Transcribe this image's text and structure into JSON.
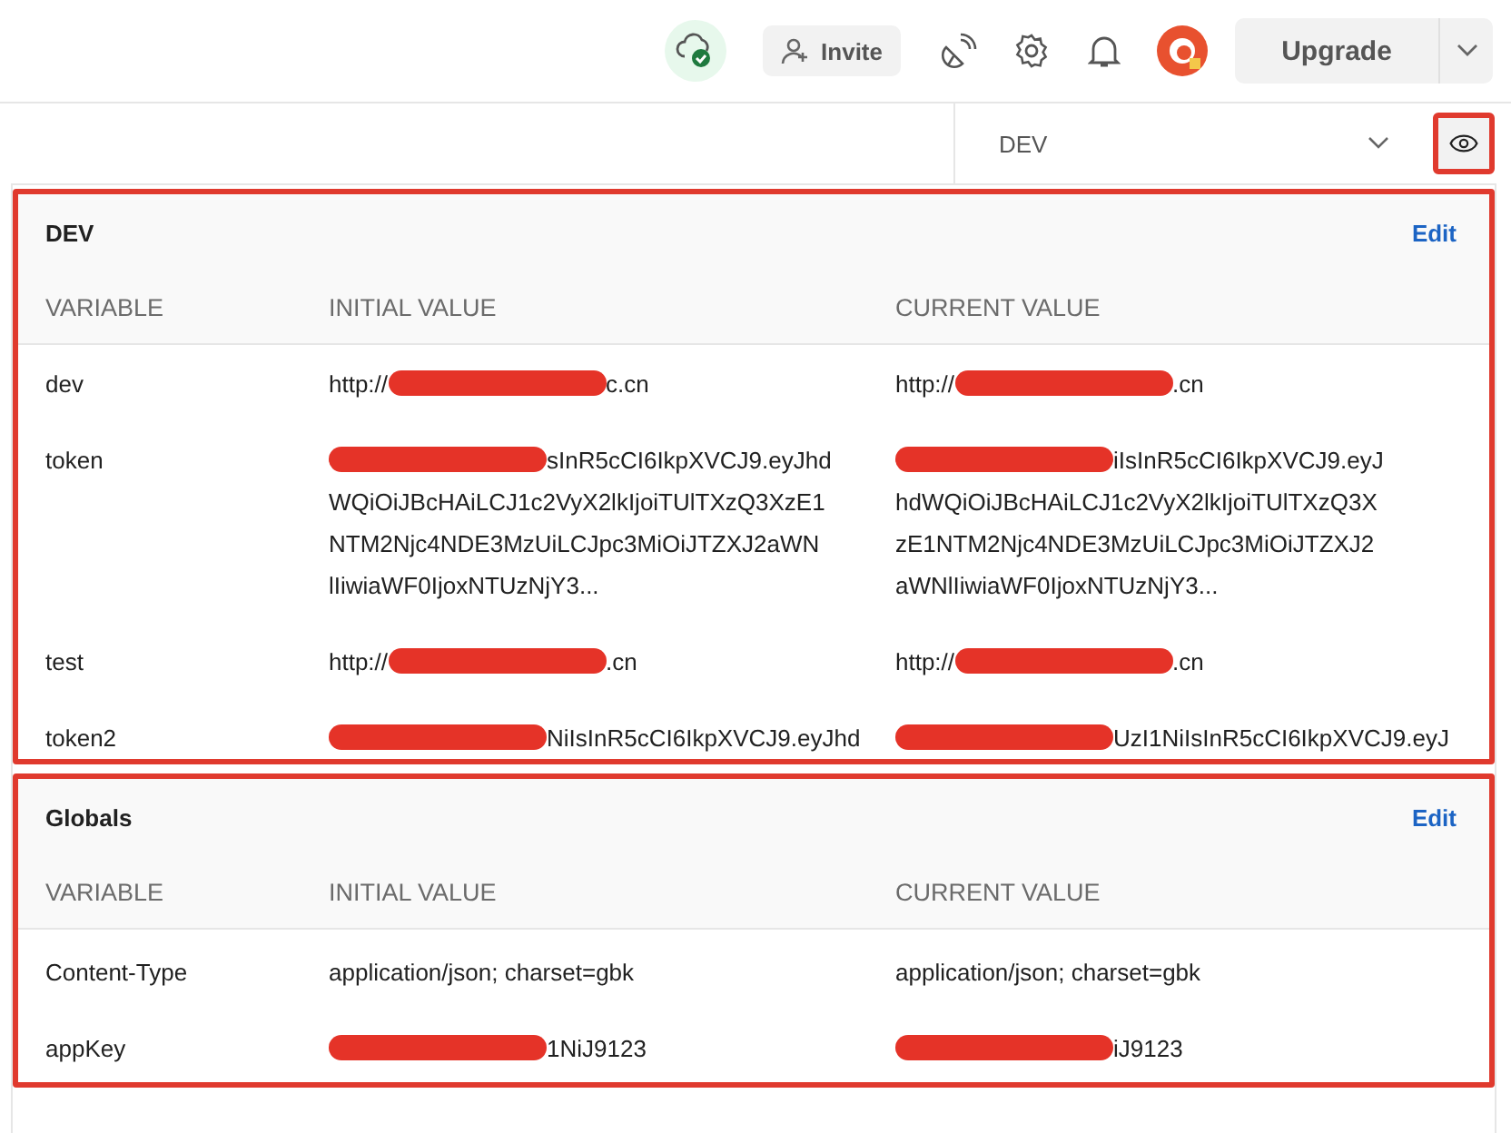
{
  "top_bar": {
    "invite_label": "Invite",
    "upgrade_label": "Upgrade"
  },
  "environment_selector": {
    "value": "DEV",
    "eye_highlighted": true
  },
  "sections": [
    {
      "title": "DEV",
      "edit_label": "Edit",
      "highlighted": true,
      "columns": [
        "VARIABLE",
        "INITIAL VALUE",
        "CURRENT VALUE"
      ],
      "rows": [
        {
          "variable": "dev",
          "initial": [
            [
              {
                "kind": "text",
                "text": "http://"
              },
              {
                "kind": "redacted"
              },
              {
                "kind": "text",
                "text": "c.cn"
              }
            ]
          ],
          "current": [
            [
              {
                "kind": "text",
                "text": "http://"
              },
              {
                "kind": "redacted"
              },
              {
                "kind": "text",
                "text": ".cn"
              }
            ]
          ]
        },
        {
          "variable": "token",
          "initial": [
            [
              {
                "kind": "redacted"
              },
              {
                "kind": "text",
                "text": "sInR5cCI6IkpXVCJ9.eyJhd"
              }
            ],
            [
              {
                "kind": "text",
                "text": "WQiOiJBcHAiLCJ1c2VyX2lkIjoiTUlTXzQ3XzE1"
              }
            ],
            [
              {
                "kind": "text",
                "text": "NTM2Njc4NDE3MzUiLCJpc3MiOiJTZXJ2aWN"
              }
            ],
            [
              {
                "kind": "text",
                "text": "lIiwiaWF0IjoxNTUzNjY3..."
              }
            ]
          ],
          "current": [
            [
              {
                "kind": "redacted"
              },
              {
                "kind": "text",
                "text": "iIsInR5cCI6IkpXVCJ9.eyJ"
              }
            ],
            [
              {
                "kind": "text",
                "text": "hdWQiOiJBcHAiLCJ1c2VyX2lkIjoiTUlTXzQ3X"
              }
            ],
            [
              {
                "kind": "text",
                "text": "zE1NTM2Njc4NDE3MzUiLCJpc3MiOiJTZXJ2"
              }
            ],
            [
              {
                "kind": "text",
                "text": "aWNlIiwiaWF0IjoxNTUzNjY3..."
              }
            ]
          ]
        },
        {
          "variable": "test",
          "initial": [
            [
              {
                "kind": "text",
                "text": "http://"
              },
              {
                "kind": "redacted"
              },
              {
                "kind": "text",
                "text": ".cn"
              }
            ]
          ],
          "current": [
            [
              {
                "kind": "text",
                "text": "http://"
              },
              {
                "kind": "redacted"
              },
              {
                "kind": "text",
                "text": ".cn"
              }
            ]
          ]
        },
        {
          "variable": "token2",
          "initial": [
            [
              {
                "kind": "redacted"
              },
              {
                "kind": "text",
                "text": "NiIsInR5cCI6IkpXVCJ9.eyJhd"
              }
            ]
          ],
          "current": [
            [
              {
                "kind": "redacted"
              },
              {
                "kind": "text",
                "text": "UzI1NiIsInR5cCI6IkpXVCJ9.eyJ"
              }
            ]
          ]
        }
      ]
    },
    {
      "title": "Globals",
      "edit_label": "Edit",
      "highlighted": true,
      "columns": [
        "VARIABLE",
        "INITIAL VALUE",
        "CURRENT VALUE"
      ],
      "rows": [
        {
          "variable": "Content-Type",
          "initial": [
            [
              {
                "kind": "text",
                "text": "application/json; charset=gbk"
              }
            ]
          ],
          "current": [
            [
              {
                "kind": "text",
                "text": "application/json; charset=gbk"
              }
            ]
          ]
        },
        {
          "variable": "appKey",
          "initial": [
            [
              {
                "kind": "redacted"
              },
              {
                "kind": "text",
                "text": "1NiJ9123"
              }
            ]
          ],
          "current": [
            [
              {
                "kind": "redacted"
              },
              {
                "kind": "text",
                "text": "iJ9123"
              }
            ]
          ]
        }
      ]
    }
  ]
}
